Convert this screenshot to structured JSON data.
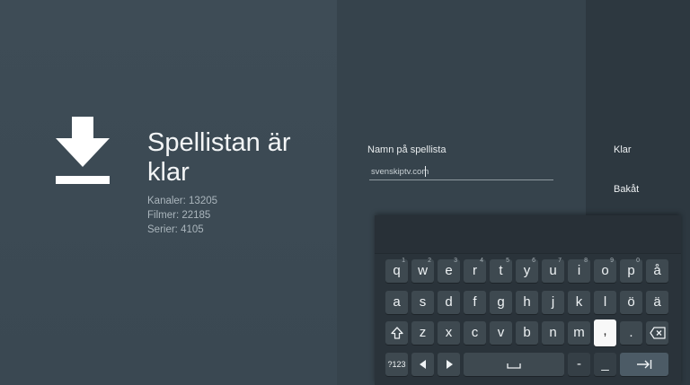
{
  "panel": {
    "title": "Spellistan är klar",
    "stats": [
      "Kanaler: 13205",
      "Filmer: 22185",
      "Serier: 4105"
    ]
  },
  "form": {
    "label": "Namn på spellista",
    "value": "svenskiptv.com"
  },
  "actions": {
    "done": "Klar",
    "back": "Bakåt"
  },
  "keyboard": {
    "row1": [
      {
        "k": "q",
        "h": "1"
      },
      {
        "k": "w",
        "h": "2"
      },
      {
        "k": "e",
        "h": "3"
      },
      {
        "k": "r",
        "h": "4"
      },
      {
        "k": "t",
        "h": "5"
      },
      {
        "k": "y",
        "h": "6"
      },
      {
        "k": "u",
        "h": "7"
      },
      {
        "k": "i",
        "h": "8"
      },
      {
        "k": "o",
        "h": "9"
      },
      {
        "k": "p",
        "h": "0"
      },
      {
        "k": "å",
        "h": ""
      }
    ],
    "row2": [
      "a",
      "s",
      "d",
      "f",
      "g",
      "h",
      "j",
      "k",
      "l",
      "ö",
      "ä"
    ],
    "row3": [
      "z",
      "x",
      "c",
      "v",
      "b",
      "n",
      "m",
      ",",
      "."
    ],
    "symbols": "?123",
    "dash": "-",
    "underscore": "_"
  },
  "colors": {
    "left_bg": "#3e4c56",
    "middle_bg": "#36434c",
    "right_bg": "#2d3840",
    "keyboard_bg": "#2a333a",
    "key_bg": "#3e4950",
    "focused_key": "#f8f8f8"
  },
  "icons": [
    "download-icon",
    "shift-icon",
    "backspace-icon",
    "arrow-left-icon",
    "arrow-right-icon",
    "space-icon",
    "tab-icon"
  ]
}
